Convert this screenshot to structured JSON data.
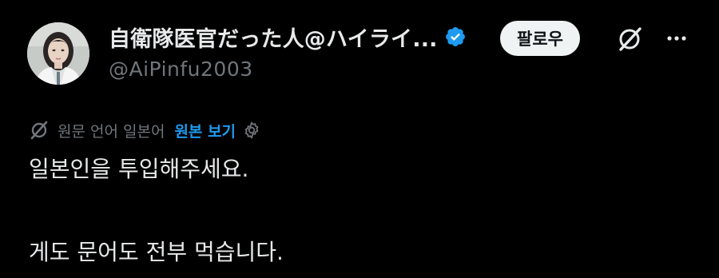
{
  "author": {
    "display_name": "自衛隊医官だった人@ハイライ...",
    "handle": "@AiPinfu2003",
    "verified": true
  },
  "header": {
    "follow_label": "팔로우"
  },
  "translation": {
    "note": "원문 언어 일본어",
    "show_original_label": "원본 보기"
  },
  "tweet": {
    "lines": [
      "일본인을 투입해주세요.",
      "게도 문어도 전부 먹습니다."
    ]
  },
  "colors": {
    "background": "#000000",
    "primary_text": "#e7e9ea",
    "secondary_text": "#71767b",
    "accent_blue": "#1d9bf0",
    "follow_button_bg": "#eff3f4"
  },
  "icons": {
    "verified": "verified-badge-icon",
    "grok": "grok-icon",
    "more": "more-options-icon",
    "translate": "translate-icon",
    "settings": "settings-gear-icon"
  }
}
